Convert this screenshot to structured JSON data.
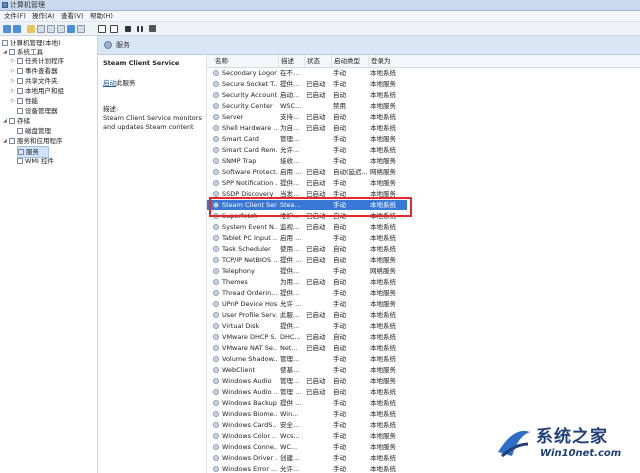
{
  "window": {
    "title": "计算机管理"
  },
  "menu": [
    "文件(F)",
    "操作(A)",
    "查看(V)",
    "帮助(H)"
  ],
  "tree": {
    "root": "计算机管理(本地)",
    "system_tools": "系统工具",
    "task_scheduler": "任务计划程序",
    "event_viewer": "事件查看器",
    "shared_folders": "共享文件夹",
    "local_users": "本地用户和组",
    "performance": "性能",
    "device_manager": "设备管理器",
    "storage": "存储",
    "disk_mgmt": "磁盘管理",
    "services_apps": "服务和应用程序",
    "services": "服务",
    "wmi": "WMI 控件"
  },
  "panel": {
    "title": "服务",
    "service_name": "Steam Client Service",
    "stop_link": "启动",
    "stop_suffix": "此服务",
    "desc_label": "描述:",
    "desc_text": "Steam Client Service monitors and updates Steam content"
  },
  "columns": {
    "name": "名称",
    "desc": "描述",
    "status": "状态",
    "startup": "启动类型",
    "logon": "登录为"
  },
  "services": [
    {
      "name": "Secondary Logon",
      "desc": "在不...",
      "status": "",
      "startup": "手动",
      "logon": "本地系统"
    },
    {
      "name": "Secure Socket T...",
      "desc": "提供...",
      "status": "已启动",
      "startup": "手动",
      "logon": "本地服务"
    },
    {
      "name": "Security Account...",
      "desc": "启动...",
      "status": "已启动",
      "startup": "自动",
      "logon": "本地系统"
    },
    {
      "name": "Security Center",
      "desc": "WSC...",
      "status": "",
      "startup": "禁用",
      "logon": "本地服务"
    },
    {
      "name": "Server",
      "desc": "支持...",
      "status": "已启动",
      "startup": "自动",
      "logon": "本地系统"
    },
    {
      "name": "Shell Hardware ...",
      "desc": "为自...",
      "status": "已启动",
      "startup": "自动",
      "logon": "本地系统"
    },
    {
      "name": "Smart Card",
      "desc": "管理...",
      "status": "",
      "startup": "手动",
      "logon": "本地服务"
    },
    {
      "name": "Smart Card Rem...",
      "desc": "允许...",
      "status": "",
      "startup": "手动",
      "logon": "本地系统"
    },
    {
      "name": "SNMP Trap",
      "desc": "接收...",
      "status": "",
      "startup": "手动",
      "logon": "本地服务"
    },
    {
      "name": "Software Protect...",
      "desc": "启用 ...",
      "status": "已启动",
      "startup": "自动(延迟...",
      "logon": "网络服务"
    },
    {
      "name": "SPP Notification ...",
      "desc": "提供...",
      "status": "已启动",
      "startup": "手动",
      "logon": "本地服务"
    },
    {
      "name": "SSDP Discovery",
      "desc": "当发...",
      "status": "已启动",
      "startup": "手动",
      "logon": "本地服务"
    },
    {
      "name": "Steam Client Ser...",
      "desc": "Stea...",
      "status": "",
      "startup": "手动",
      "logon": "本地系统"
    },
    {
      "name": "Superfetch",
      "desc": "维护...",
      "status": "已启动",
      "startup": "自动",
      "logon": "本地系统"
    },
    {
      "name": "System Event N...",
      "desc": "监视...",
      "status": "已启动",
      "startup": "自动",
      "logon": "本地系统"
    },
    {
      "name": "Tablet PC Input ...",
      "desc": "启用 ...",
      "status": "",
      "startup": "手动",
      "logon": "本地系统"
    },
    {
      "name": "Task Scheduler",
      "desc": "使用...",
      "status": "已启动",
      "startup": "自动",
      "logon": "本地系统"
    },
    {
      "name": "TCP/IP NetBIOS ...",
      "desc": "提供 ...",
      "status": "已启动",
      "startup": "自动",
      "logon": "本地服务"
    },
    {
      "name": "Telephony",
      "desc": "提供...",
      "status": "",
      "startup": "手动",
      "logon": "网络服务"
    },
    {
      "name": "Themes",
      "desc": "为用...",
      "status": "已启动",
      "startup": "自动",
      "logon": "本地系统"
    },
    {
      "name": "Thread Orderin...",
      "desc": "提供...",
      "status": "",
      "startup": "手动",
      "logon": "本地服务"
    },
    {
      "name": "UPnP Device Host",
      "desc": "允许 ...",
      "status": "",
      "startup": "手动",
      "logon": "本地服务"
    },
    {
      "name": "User Profile Serv...",
      "desc": "此服...",
      "status": "已启动",
      "startup": "自动",
      "logon": "本地系统"
    },
    {
      "name": "Virtual Disk",
      "desc": "提供...",
      "status": "",
      "startup": "手动",
      "logon": "本地系统"
    },
    {
      "name": "VMware DHCP S...",
      "desc": "DHC...",
      "status": "已启动",
      "startup": "自动",
      "logon": "本地系统"
    },
    {
      "name": "VMware NAT Se...",
      "desc": "Net...",
      "status": "已启动",
      "startup": "自动",
      "logon": "本地系统"
    },
    {
      "name": "Volume Shadow...",
      "desc": "管理...",
      "status": "",
      "startup": "手动",
      "logon": "本地系统"
    },
    {
      "name": "WebClient",
      "desc": "使基...",
      "status": "",
      "startup": "手动",
      "logon": "本地服务"
    },
    {
      "name": "Windows Audio",
      "desc": "管理...",
      "status": "已启动",
      "startup": "自动",
      "logon": "本地服务"
    },
    {
      "name": "Windows Audio ...",
      "desc": "管理 ...",
      "status": "已启动",
      "startup": "自动",
      "logon": "本地系统"
    },
    {
      "name": "Windows Backup",
      "desc": "提供 ...",
      "status": "",
      "startup": "手动",
      "logon": "本地系统"
    },
    {
      "name": "Windows Biome...",
      "desc": "Win...",
      "status": "",
      "startup": "手动",
      "logon": "本地系统"
    },
    {
      "name": "Windows CardS...",
      "desc": "安全...",
      "status": "",
      "startup": "手动",
      "logon": "本地系统"
    },
    {
      "name": "Windows Color ...",
      "desc": "Wcs...",
      "status": "",
      "startup": "手动",
      "logon": "本地服务"
    },
    {
      "name": "Windows Conne...",
      "desc": "WC...",
      "status": "",
      "startup": "手动",
      "logon": "本地服务"
    },
    {
      "name": "Windows Driver ...",
      "desc": "创建...",
      "status": "",
      "startup": "手动",
      "logon": "本地系统"
    },
    {
      "name": "Windows Error ...",
      "desc": "允许...",
      "status": "",
      "startup": "手动",
      "logon": "本地系统"
    }
  ],
  "watermark": {
    "brand": "系统之家",
    "url": "Win10net.com"
  },
  "colors": {
    "selection": "#3a78d6",
    "highlight_box": "#e22b2b"
  }
}
